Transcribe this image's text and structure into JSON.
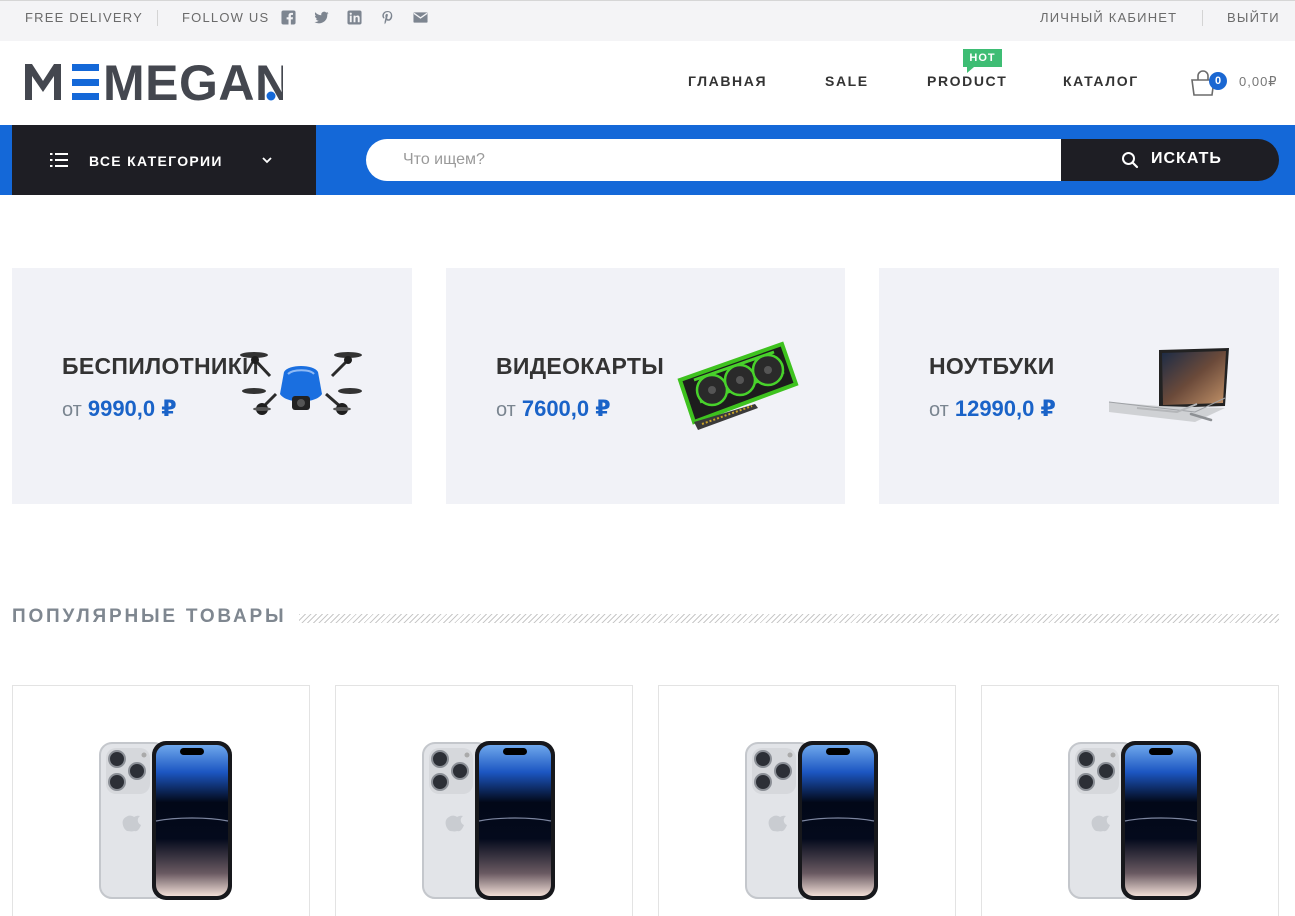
{
  "topbar": {
    "free_delivery": "FREE DELIVERY",
    "follow_us": "FOLLOW US",
    "social_icons": [
      "facebook-icon",
      "twitter-icon",
      "linkedin-icon",
      "pinterest-icon",
      "mail-icon"
    ],
    "account": "ЛИЧНЫЙ КАБИНЕТ",
    "logout": "ВЫЙТИ"
  },
  "header": {
    "logo_text": "MEGANO",
    "nav": [
      "ГЛАВНАЯ",
      "SALE",
      "PRODUCT",
      "КАТАЛОГ"
    ],
    "hot_badge": "HOT",
    "cart_count": "0",
    "cart_total": "0,00₽"
  },
  "search": {
    "categories_label": "ВСЕ КАТЕГОРИИ",
    "placeholder": "Что ищем?",
    "button_label": "ИСКАТЬ"
  },
  "banners": [
    {
      "title": "БЕСПИЛОТНИКИ",
      "from": "от",
      "price": "9990,0 ₽",
      "image": "drone"
    },
    {
      "title": "ВИДЕОКАРТЫ",
      "from": "от",
      "price": "7600,0 ₽",
      "image": "graphics-card"
    },
    {
      "title": "НОУТБУКИ",
      "from": "от",
      "price": "12990,0 ₽",
      "image": "laptop"
    }
  ],
  "popular": {
    "title": "ПОПУЛЯРНЫЕ ТОВАРЫ",
    "products": [
      {
        "image": "iphone-silver"
      },
      {
        "image": "iphone-silver"
      },
      {
        "image": "iphone-silver"
      },
      {
        "image": "iphone-silver"
      }
    ]
  },
  "colors": {
    "brand_blue": "#1468d8",
    "dark": "#1e1e24",
    "hot_green": "#3ebd74",
    "price_blue": "#1a63c8"
  }
}
